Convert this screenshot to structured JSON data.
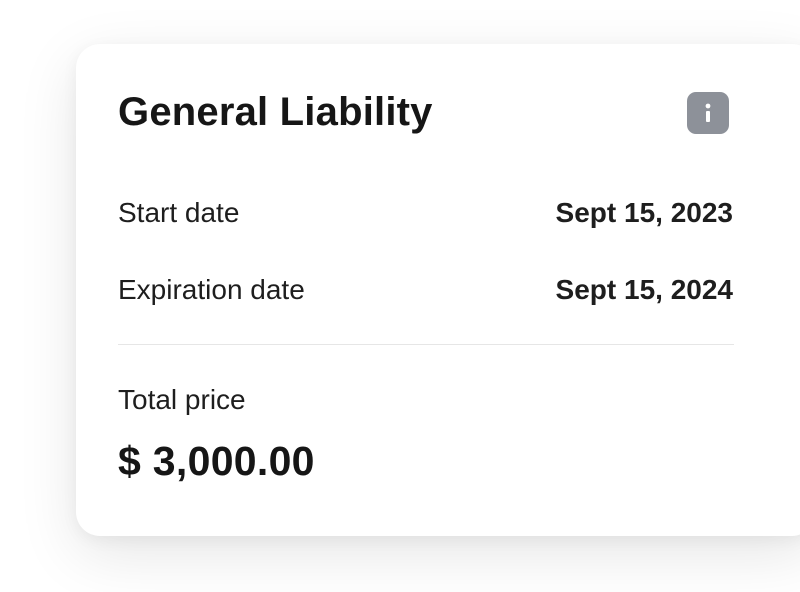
{
  "card": {
    "title": "General Liability",
    "info_icon": "info-icon",
    "rows": [
      {
        "label": "Start date",
        "value": "Sept 15, 2023"
      },
      {
        "label": "Expiration date",
        "value": "Sept 15, 2024"
      }
    ],
    "total": {
      "label": "Total price",
      "value": "$ 3,000.00"
    }
  },
  "colors": {
    "text": "#161616",
    "info_button_bg": "#8d9199",
    "divider": "#e6e6e6",
    "card_bg": "#ffffff"
  }
}
